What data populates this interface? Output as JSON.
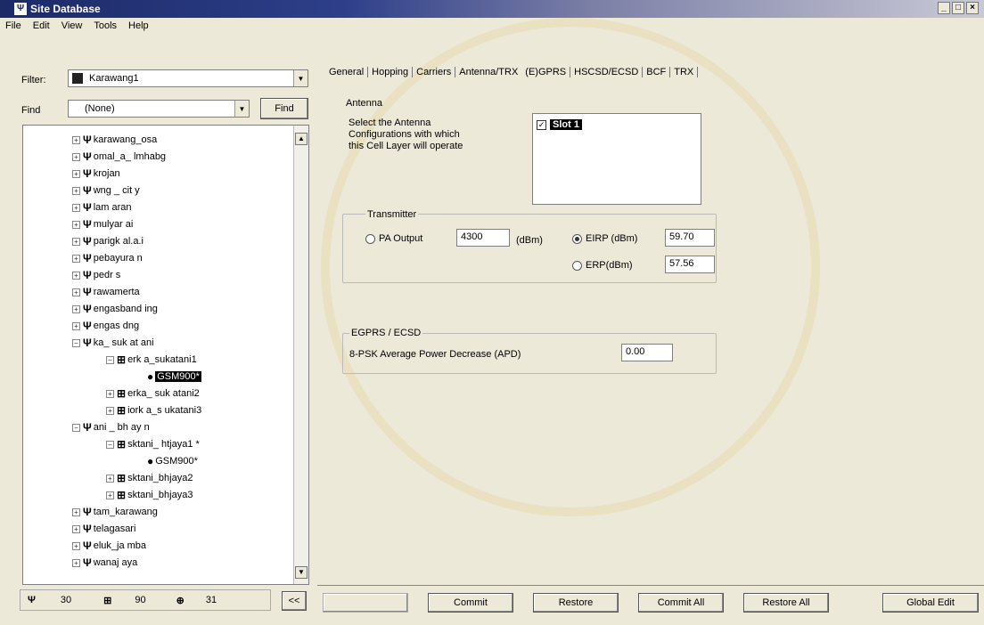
{
  "window": {
    "title": "Site Database"
  },
  "menu": [
    "File",
    "Edit",
    "View",
    "Tools",
    "Help"
  ],
  "filter": {
    "label": "Filter:",
    "value": "Karawang1"
  },
  "find": {
    "label": "Find",
    "value": "(None)",
    "button": "Find"
  },
  "tree": {
    "rows": [
      {
        "label": "karawang_osa",
        "indent": 80,
        "icon": "Ψ",
        "exp": "+"
      },
      {
        "label": "omal_a_ lmhabg",
        "indent": 80,
        "icon": "Ψ",
        "exp": "+"
      },
      {
        "label": "krojan",
        "indent": 80,
        "icon": "Ψ",
        "exp": "+"
      },
      {
        "label": "wng _ cit y",
        "indent": 80,
        "icon": "Ψ",
        "exp": "+"
      },
      {
        "label": "lam aran",
        "indent": 80,
        "icon": "Ψ",
        "exp": "+"
      },
      {
        "label": "mulyar ai",
        "indent": 80,
        "icon": "Ψ",
        "exp": "+"
      },
      {
        "label": "parigk al.a.i",
        "indent": 80,
        "icon": "Ψ",
        "exp": "+"
      },
      {
        "label": "pebayura n",
        "indent": 80,
        "icon": "Ψ",
        "exp": "+"
      },
      {
        "label": "pedr s",
        "indent": 80,
        "icon": "Ψ",
        "exp": "+"
      },
      {
        "label": "rawamerta",
        "indent": 80,
        "icon": "Ψ",
        "exp": "+"
      },
      {
        "label": "engasband ing",
        "indent": 80,
        "icon": "Ψ",
        "exp": "+"
      },
      {
        "label": "engas dng",
        "indent": 80,
        "icon": "Ψ",
        "exp": "+"
      },
      {
        "label": "ka_ suk at ani",
        "indent": 80,
        "icon": "Ψ",
        "exp": "−"
      },
      {
        "label": "erk a_sukatani1",
        "indent": 118,
        "icon": "⊞",
        "exp": "−"
      },
      {
        "label": "GSM900*",
        "indent": 152,
        "icon": "●",
        "exp": "",
        "selected": true
      },
      {
        "label": "erka_ suk atani2",
        "indent": 118,
        "icon": "⊞",
        "exp": "+"
      },
      {
        "label": "iork a_s ukatani3",
        "indent": 118,
        "icon": "⊞",
        "exp": "+"
      },
      {
        "label": "ani _ bh ay n",
        "indent": 80,
        "icon": "Ψ",
        "exp": "−"
      },
      {
        "label": "sktani_ htjaya1 *",
        "indent": 118,
        "icon": "⊞",
        "exp": "−"
      },
      {
        "label": "GSM900*",
        "indent": 152,
        "icon": "●",
        "exp": ""
      },
      {
        "label": "sktani_bhjaya2",
        "indent": 118,
        "icon": "⊞",
        "exp": "+"
      },
      {
        "label": "sktani_bhjaya3",
        "indent": 118,
        "icon": "⊞",
        "exp": "+"
      },
      {
        "label": "tam_karawang",
        "indent": 80,
        "icon": "Ψ",
        "exp": "+"
      },
      {
        "label": "telagasari",
        "indent": 80,
        "icon": "Ψ",
        "exp": "+"
      },
      {
        "label": "eluk_ja mba",
        "indent": 80,
        "icon": "Ψ",
        "exp": "+"
      },
      {
        "label": "wanaj aya",
        "indent": 80,
        "icon": "Ψ",
        "exp": "+"
      }
    ]
  },
  "statusbar": {
    "sites": "30",
    "cells": "90",
    "layers": "31",
    "nav": "<<"
  },
  "tabs": [
    "General",
    "Hopping",
    "Carriers",
    "Antenna/TRX",
    "(E)GPRS",
    "HSCSD/ECSD",
    "BCF",
    "TRX"
  ],
  "antenna": {
    "group_label": "Antenna",
    "help": [
      "Select the Antenna",
      "Configurations with which",
      "this Cell Layer will operate"
    ],
    "slot": "Slot 1"
  },
  "transmitter": {
    "group_label": "Transmitter",
    "pa_label": "PA Output",
    "pa_value": "4300",
    "pa_unit": "(dBm)",
    "eirp_label": "EIRP (dBm)",
    "eirp_value": "59.70",
    "erp_label": "ERP(dBm)",
    "erp_value": "57.56"
  },
  "egprs": {
    "group_label": "EGPRS / ECSD",
    "apd_label": "8-PSK Average Power Decrease (APD)",
    "apd_value": "0.00"
  },
  "bottom_buttons": {
    "commit": "Commit",
    "restore": "Restore",
    "commit_all": "Commit All",
    "restore_all": "Restore All",
    "global_edit": "Global Edit"
  }
}
